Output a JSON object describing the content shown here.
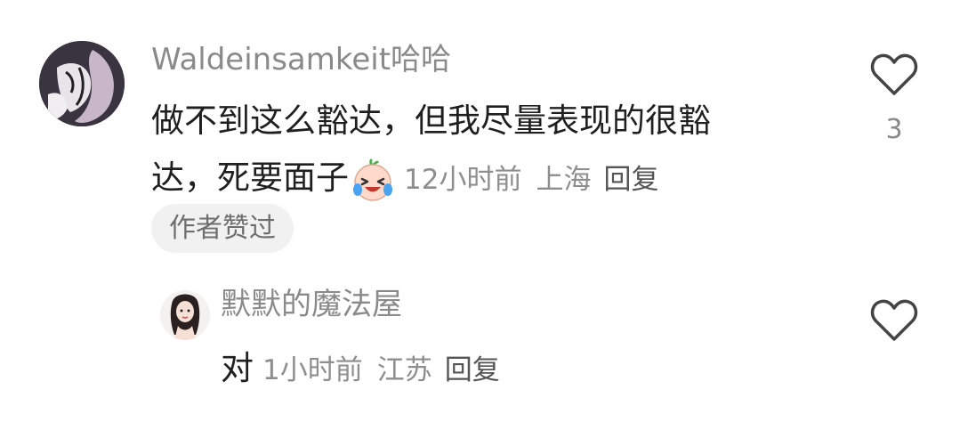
{
  "comment": {
    "username": "Waldeinsamkeit哈哈",
    "text_line1": "做不到这么豁达，但我尽量表现的很豁",
    "text_line2": "达，死要面子",
    "emoji": "crying-laughing-emoji",
    "time": "12小时前",
    "location": "上海",
    "reply_label": "回复",
    "author_liked_badge": "作者赞过",
    "like_count": "3"
  },
  "reply": {
    "username": "默默的魔法屋",
    "text": "对",
    "time": "1小时前",
    "location": "江苏",
    "reply_label": "回复"
  },
  "icons": {
    "like": "heart-outline-icon"
  }
}
